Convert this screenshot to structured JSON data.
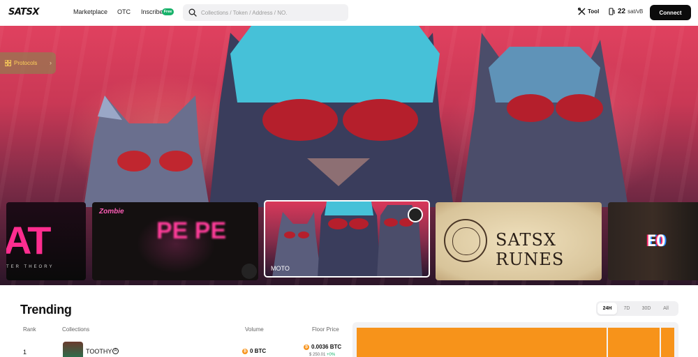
{
  "header": {
    "logo": "SATSX",
    "nav": [
      {
        "label": "Marketplace"
      },
      {
        "label": "OTC"
      },
      {
        "label": "Inscribe",
        "badge": "Free"
      }
    ],
    "search": {
      "placeholder": "Collections / Token / Address / NO."
    },
    "tool_label": "Tool",
    "gas": {
      "value": "22",
      "unit": "sat/vB"
    },
    "connect_label": "Connect"
  },
  "hero": {
    "protocols_label": "Protocols",
    "cards": [
      {
        "title": "AT",
        "caption": "TER THEORY"
      },
      {
        "title": "PE PE",
        "caption": "Zombie"
      },
      {
        "label": "MOTO",
        "selected": true
      },
      {
        "title": "SATSX RUNES"
      },
      {
        "title": "EO"
      }
    ]
  },
  "trending": {
    "title": "Trending",
    "ranges": [
      "24H",
      "7D",
      "30D",
      "All"
    ],
    "active_range": "24H",
    "columns": {
      "rank": "Rank",
      "collections": "Collections",
      "volume": "Volume",
      "floor": "Floor Price"
    },
    "rows": [
      {
        "rank": "1",
        "name": "TOOTHY",
        "volume": "0 BTC",
        "floor": "0.0036 BTC",
        "floor_usd": "$ 250.01",
        "change": "+0%"
      }
    ]
  },
  "colors": {
    "accent": "#f7931a",
    "connect_bg": "#0b0b0b",
    "free_badge": "#19b26b",
    "hero_pink": "#e0415f"
  }
}
